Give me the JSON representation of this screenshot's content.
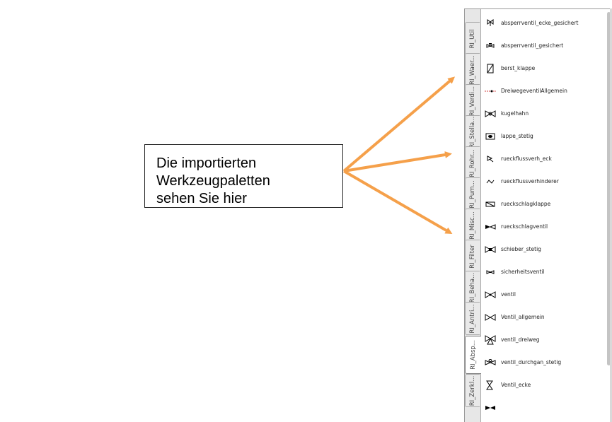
{
  "callout": {
    "text": "Die importierten Werkzeugpaletten\nsehen Sie hier"
  },
  "palette": {
    "tabs": [
      {
        "label": "RI_Util"
      },
      {
        "label": "RI_Waer..."
      },
      {
        "label": "RI_Verdi..."
      },
      {
        "label": "RI_Stella..."
      },
      {
        "label": "RI_Rohr..."
      },
      {
        "label": "RI_Pum..."
      },
      {
        "label": "RI_Misc..."
      },
      {
        "label": "RI_Filter"
      },
      {
        "label": "RI_Beha..."
      },
      {
        "label": "RI_Antri..."
      },
      {
        "label": "RI_Absp...",
        "active": true
      },
      {
        "label": "RI_Zerkl..."
      }
    ],
    "items": [
      {
        "label": "absperrventil_ecke_gesichert",
        "icon": "angle-valve-secured-icon"
      },
      {
        "label": "absperrventil_gesichert",
        "icon": "valve-secured-icon"
      },
      {
        "label": "berst_klappe",
        "icon": "burst-flap-icon"
      },
      {
        "label": "DreiwegeventilAllgemein",
        "icon": "three-way-valve-line-icon"
      },
      {
        "label": "kugelhahn",
        "icon": "ball-valve-icon"
      },
      {
        "label": "lappe_stetig",
        "icon": "flap-continuous-icon"
      },
      {
        "label": "rueckflussverh_eck",
        "icon": "backflow-preventer-angle-icon"
      },
      {
        "label": "rueckflussverhinderer",
        "icon": "backflow-preventer-icon"
      },
      {
        "label": "rueckschlagklappe",
        "icon": "check-flap-icon"
      },
      {
        "label": "rueckschlagventil",
        "icon": "check-valve-icon"
      },
      {
        "label": "schieber_stetig",
        "icon": "gate-valve-continuous-icon"
      },
      {
        "label": "sicherheitsventil",
        "icon": "safety-valve-icon"
      },
      {
        "label": "ventil",
        "icon": "valve-icon"
      },
      {
        "label": "Ventil_allgemein",
        "icon": "valve-general-icon"
      },
      {
        "label": "ventil_dreiweg",
        "icon": "three-way-valve-icon"
      },
      {
        "label": "ventil_durchgan_stetig",
        "icon": "through-valve-continuous-icon"
      },
      {
        "label": "Ventil_ecke",
        "icon": "angle-valve-icon"
      },
      {
        "label": "",
        "icon": "valve-filled-icon"
      }
    ]
  },
  "colors": {
    "arrow": "#f5a04a",
    "red_line": "#d04040"
  }
}
